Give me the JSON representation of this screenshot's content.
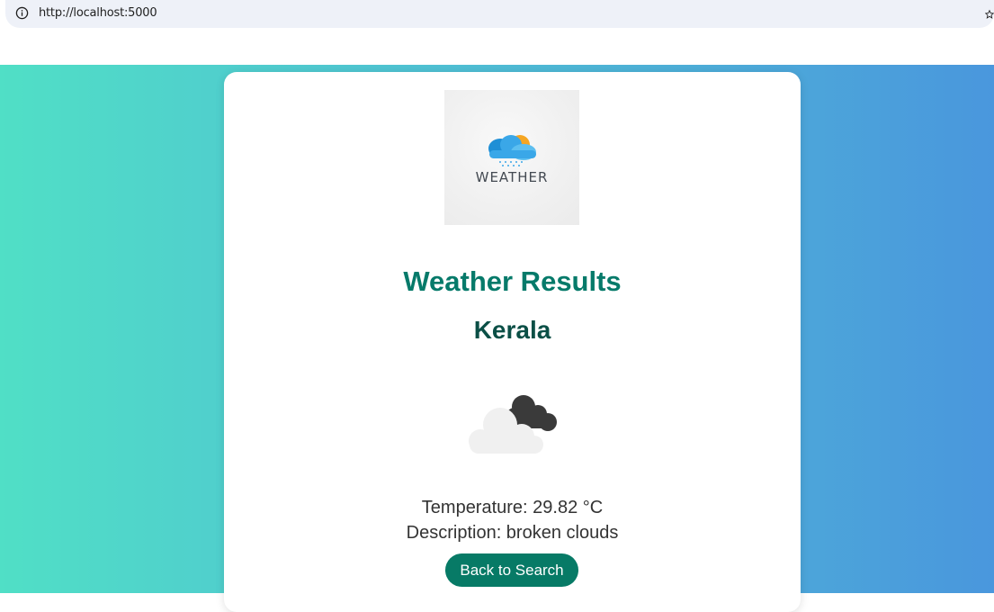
{
  "browser": {
    "url": "http://localhost:5000",
    "info_icon": "info-circle-icon",
    "star_icon": "bookmark-star-icon"
  },
  "colors": {
    "gradient_start": "#50dfc6",
    "gradient_end": "#4a97dd",
    "title": "#067a6a",
    "city": "#0b4f46",
    "button": "#077a66"
  },
  "logo": {
    "text": "WEATHER",
    "icon": "cloud-sun-rain-icon"
  },
  "results": {
    "title": "Weather Results",
    "city": "Kerala",
    "weather_icon": "broken-clouds-icon",
    "temperature": "Temperature: 29.82 °C",
    "description": "Description: broken clouds"
  },
  "actions": {
    "back_label": "Back to Search"
  }
}
